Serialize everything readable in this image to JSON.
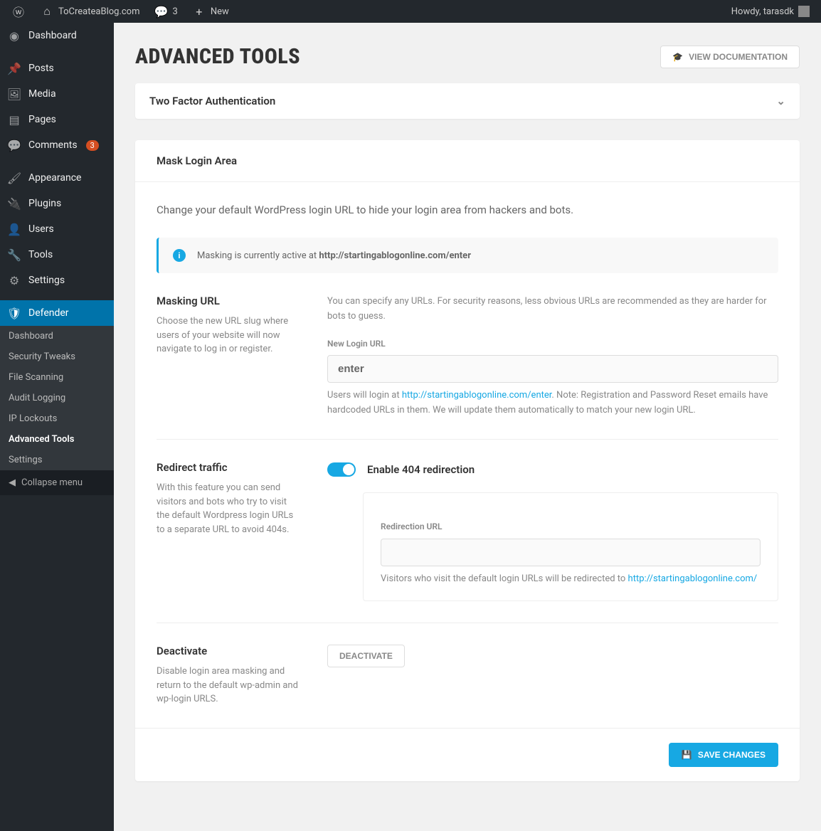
{
  "topbar": {
    "site_name": "ToCreateaBlog.com",
    "comment_count": "3",
    "new_label": "New",
    "howdy": "Howdy, tarasdk"
  },
  "sidebar": {
    "items": [
      {
        "icon": "dashboard",
        "label": "Dashboard"
      },
      {
        "icon": "pin",
        "label": "Posts"
      },
      {
        "icon": "media",
        "label": "Media"
      },
      {
        "icon": "page",
        "label": "Pages"
      },
      {
        "icon": "comment",
        "label": "Comments",
        "badge": "3"
      },
      {
        "icon": "brush",
        "label": "Appearance"
      },
      {
        "icon": "plug",
        "label": "Plugins"
      },
      {
        "icon": "user",
        "label": "Users"
      },
      {
        "icon": "wrench",
        "label": "Tools"
      },
      {
        "icon": "sliders",
        "label": "Settings"
      },
      {
        "icon": "shield",
        "label": "Defender"
      }
    ],
    "submenu": [
      "Dashboard",
      "Security Tweaks",
      "File Scanning",
      "Audit Logging",
      "IP Lockouts",
      "Advanced Tools",
      "Settings"
    ],
    "collapse": "Collapse menu"
  },
  "page": {
    "title": "ADVANCED TOOLS",
    "doc_btn": "VIEW DOCUMENTATION"
  },
  "panel_2fa": {
    "title": "Two Factor Authentication"
  },
  "mask": {
    "header": "Mask Login Area",
    "intro": "Change your default WordPress login URL to hide your login area from hackers and bots.",
    "notice_prefix": "Masking is currently active at ",
    "notice_url": "http://startingablogonline.com/enter",
    "url_section": {
      "title": "Masking URL",
      "desc": "Choose the new URL slug where users of your website will now navigate to log in or register.",
      "content_intro": "You can specify any URLs. For security reasons, less obvious URLs are recommended as they are harder for bots to guess.",
      "field_label": "New Login URL",
      "field_value": "enter",
      "help_before": "Users will login at ",
      "help_link": "http://startingablogonline.com/enter",
      "help_after": ". Note: Registration and Password Reset emails have hardcoded URLs in them. We will update them automatically to match your new login URL."
    },
    "redirect": {
      "title": "Redirect traffic",
      "desc": "With this feature you can send visitors and bots who try to visit the default Wordpress login URLs to a separate URL to avoid 404s.",
      "toggle_label": "Enable 404 redirection",
      "sub_field_label": "Redirection URL",
      "sub_help_before": "Visitors who visit the default login URLs will be redirected to ",
      "sub_help_link": "http://startingablogonline.com/"
    },
    "deactivate": {
      "title": "Deactivate",
      "desc": "Disable login area masking and return to the default wp-admin and wp-login URLS.",
      "btn": "DEACTIVATE"
    },
    "save_btn": "SAVE CHANGES"
  }
}
